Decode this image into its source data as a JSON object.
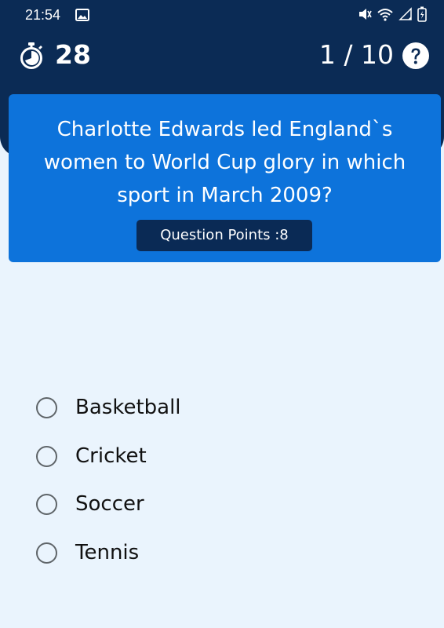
{
  "status_bar": {
    "time": "21:54",
    "icons": [
      "gallery-icon",
      "mute-icon",
      "wifi-icon",
      "signal-icon",
      "battery-icon"
    ]
  },
  "header": {
    "timer_icon": "stopwatch-icon",
    "timer_value": "28",
    "progress": "1 / 10",
    "help_icon": "help-icon"
  },
  "question": {
    "text": "Charlotte Edwards led England`s women to World Cup glory in which sport in March 2009?",
    "points": "Question Points :8"
  },
  "options": [
    {
      "label": "Basketball",
      "selected": false
    },
    {
      "label": "Cricket",
      "selected": false
    },
    {
      "label": "Soccer",
      "selected": false
    },
    {
      "label": "Tennis",
      "selected": false
    }
  ],
  "colors": {
    "header_bg": "#0b2b55",
    "card_bg": "#0d73db",
    "badge_bg": "#0a2a55",
    "page_bg": "#eaf4fd"
  }
}
